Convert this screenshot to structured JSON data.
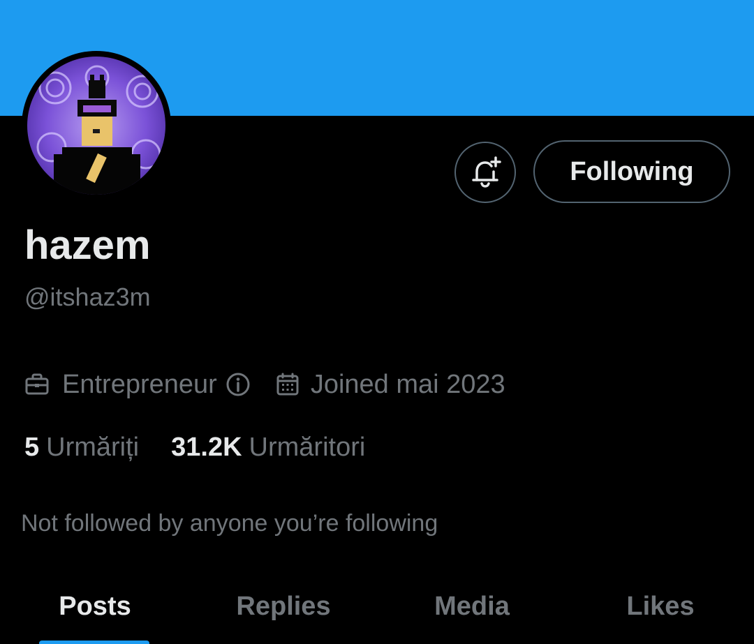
{
  "profile": {
    "display_name": "hazem",
    "handle": "@itshaz3m",
    "profession": "Entrepreneur",
    "joined": "Joined mai 2023",
    "following_count": "5",
    "following_label": "Urmăriți",
    "followers_count": "31.2K",
    "followers_label": "Urmăritori",
    "mutuals_text": "Not followed by anyone you’re following"
  },
  "actions": {
    "notify_icon": "bell-plus-icon",
    "follow_label": "Following"
  },
  "icons": {
    "profession": "briefcase-icon",
    "info": "info-circle-icon",
    "calendar": "calendar-icon"
  },
  "tabs": [
    {
      "label": "Posts",
      "active": true
    },
    {
      "label": "Replies",
      "active": false
    },
    {
      "label": "Media",
      "active": false
    },
    {
      "label": "Likes",
      "active": false
    }
  ],
  "colors": {
    "banner": "#1d9bf0",
    "background": "#000000",
    "primary_text": "#e7e9ea",
    "secondary_text": "#71767b",
    "accent": "#1d9bf0"
  }
}
